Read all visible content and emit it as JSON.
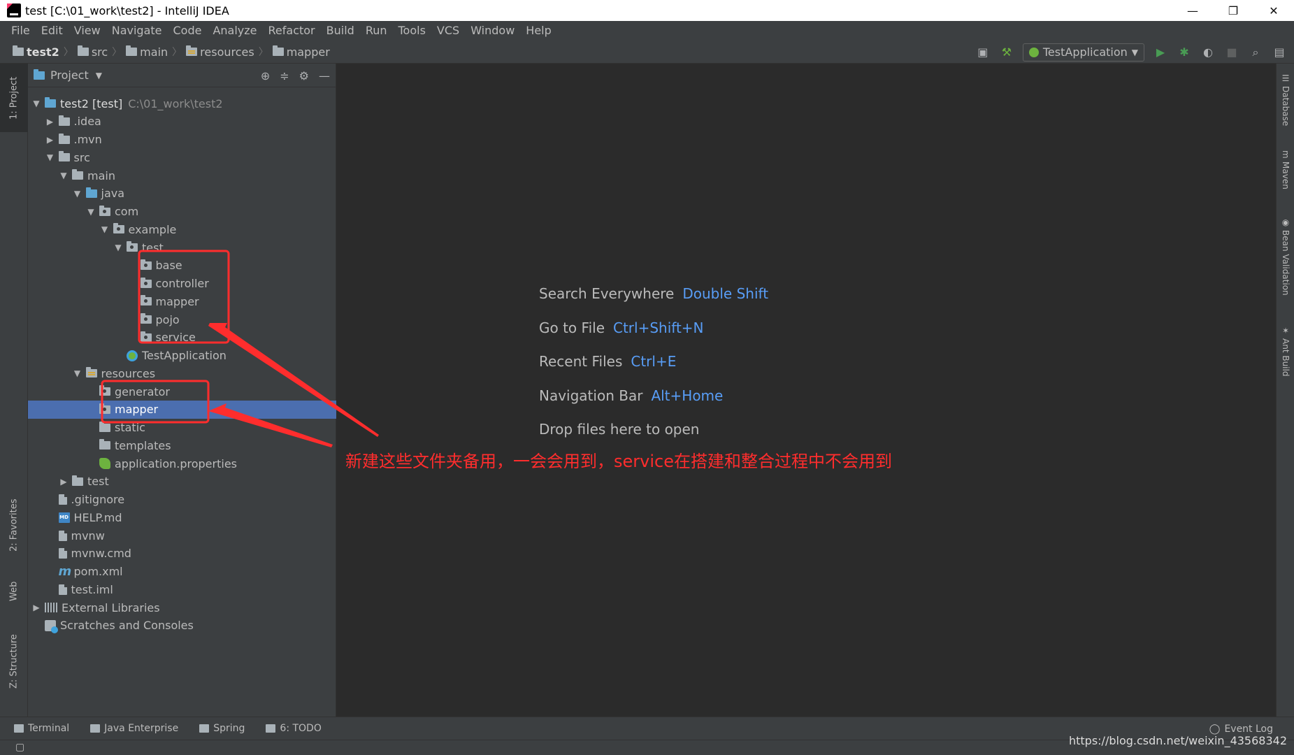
{
  "window": {
    "title": "test [C:\\01_work\\test2] - IntelliJ IDEA",
    "minimize": "—",
    "restore": "❐",
    "close": "✕"
  },
  "menu": [
    "File",
    "Edit",
    "View",
    "Navigate",
    "Code",
    "Analyze",
    "Refactor",
    "Build",
    "Run",
    "Tools",
    "VCS",
    "Window",
    "Help"
  ],
  "breadcrumbs": [
    "test2",
    "src",
    "main",
    "resources",
    "mapper"
  ],
  "toolbar": {
    "run_config": "TestApplication"
  },
  "left_tabs": {
    "project": "1: Project",
    "favorites": "2: Favorites",
    "web": "Web",
    "structure": "Z: Structure"
  },
  "right_tabs": {
    "database": "Database",
    "maven": "Maven",
    "bean_validation": "Bean Validation",
    "ant_build": "Ant Build"
  },
  "project_panel": {
    "title": "Project"
  },
  "tree": [
    {
      "label": "test2 [test]",
      "secondary": "C:\\01_work\\test2",
      "depth": 0,
      "arrow": "▼",
      "icon": "module"
    },
    {
      "label": ".idea",
      "depth": 1,
      "arrow": "▶",
      "icon": "folder"
    },
    {
      "label": ".mvn",
      "depth": 1,
      "arrow": "▶",
      "icon": "folder"
    },
    {
      "label": "src",
      "depth": 1,
      "arrow": "▼",
      "icon": "folder"
    },
    {
      "label": "main",
      "depth": 2,
      "arrow": "▼",
      "icon": "folder"
    },
    {
      "label": "java",
      "depth": 3,
      "arrow": "▼",
      "icon": "source"
    },
    {
      "label": "com",
      "depth": 4,
      "arrow": "▼",
      "icon": "package"
    },
    {
      "label": "example",
      "depth": 5,
      "arrow": "▼",
      "icon": "package"
    },
    {
      "label": "test",
      "depth": 6,
      "arrow": "▼",
      "icon": "package"
    },
    {
      "label": "base",
      "depth": 7,
      "arrow": "",
      "icon": "package"
    },
    {
      "label": "controller",
      "depth": 7,
      "arrow": "",
      "icon": "package"
    },
    {
      "label": "mapper",
      "depth": 7,
      "arrow": "",
      "icon": "package"
    },
    {
      "label": "pojo",
      "depth": 7,
      "arrow": "",
      "icon": "package"
    },
    {
      "label": "service",
      "depth": 7,
      "arrow": "",
      "icon": "package"
    },
    {
      "label": "TestApplication",
      "depth": 6,
      "arrow": "",
      "icon": "app"
    },
    {
      "label": "resources",
      "depth": 3,
      "arrow": "▼",
      "icon": "resources"
    },
    {
      "label": "generator",
      "depth": 4,
      "arrow": "",
      "icon": "package"
    },
    {
      "label": "mapper",
      "depth": 4,
      "arrow": "",
      "icon": "package",
      "selected": true
    },
    {
      "label": "static",
      "depth": 4,
      "arrow": "",
      "icon": "folder"
    },
    {
      "label": "templates",
      "depth": 4,
      "arrow": "",
      "icon": "folder"
    },
    {
      "label": "application.properties",
      "depth": 4,
      "arrow": "",
      "icon": "props"
    },
    {
      "label": "test",
      "depth": 2,
      "arrow": "▶",
      "icon": "folder"
    },
    {
      "label": ".gitignore",
      "depth": 1,
      "arrow": "",
      "icon": "file"
    },
    {
      "label": "HELP.md",
      "depth": 1,
      "arrow": "",
      "icon": "md"
    },
    {
      "label": "mvnw",
      "depth": 1,
      "arrow": "",
      "icon": "file"
    },
    {
      "label": "mvnw.cmd",
      "depth": 1,
      "arrow": "",
      "icon": "file"
    },
    {
      "label": "pom.xml",
      "depth": 1,
      "arrow": "",
      "icon": "maven"
    },
    {
      "label": "test.iml",
      "depth": 1,
      "arrow": "",
      "icon": "file"
    },
    {
      "label": "External Libraries",
      "depth": 0,
      "arrow": "▶",
      "icon": "libs"
    },
    {
      "label": "Scratches and Consoles",
      "depth": 0,
      "arrow": "",
      "icon": "scratch"
    }
  ],
  "editor_hints": [
    {
      "label": "Search Everywhere",
      "key": "Double Shift"
    },
    {
      "label": "Go to File",
      "key": "Ctrl+Shift+N"
    },
    {
      "label": "Recent Files",
      "key": "Ctrl+E"
    },
    {
      "label": "Navigation Bar",
      "key": "Alt+Home"
    },
    {
      "label": "Drop files here to open",
      "key": ""
    }
  ],
  "annotation": {
    "text": "新建这些文件夹备用，一会会用到，service在搭建和整合过程中不会用到",
    "color": "#ff2d2d"
  },
  "bottom_tabs": [
    "Terminal",
    "Java Enterprise",
    "Spring",
    "6: TODO"
  ],
  "event_log": "Event Log",
  "watermark": "https://blog.csdn.net/weixin_43568342",
  "colors": {
    "accent": "#589df6",
    "selection": "#4b6eaf",
    "panel": "#3c3f41",
    "editor": "#2b2b2b"
  }
}
